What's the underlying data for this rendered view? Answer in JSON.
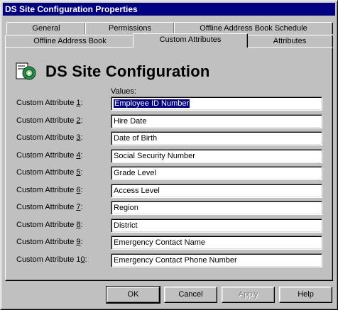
{
  "window": {
    "title": "DS Site Configuration Properties"
  },
  "tabs_back": [
    {
      "label": "General"
    },
    {
      "label": "Permissions"
    },
    {
      "label": "Offline Address Book Schedule"
    }
  ],
  "tabs_front": [
    {
      "label": "Offline Address Book"
    },
    {
      "label": "Custom Attributes",
      "active": true
    },
    {
      "label": "Attributes"
    }
  ],
  "header": {
    "title": "DS Site Configuration",
    "icon": "site-config-icon"
  },
  "values_label": "Values:",
  "attributes": [
    {
      "label_prefix": "Custom Attribute ",
      "key": "1",
      "label_suffix": ":",
      "value": "Employee ID Number",
      "selected": true
    },
    {
      "label_prefix": "Custom Attribute ",
      "key": "2",
      "label_suffix": ":",
      "value": "Hire Date"
    },
    {
      "label_prefix": "Custom Attribute ",
      "key": "3",
      "label_suffix": ":",
      "value": "Date of Birth"
    },
    {
      "label_prefix": "Custom Attribute ",
      "key": "4",
      "label_suffix": ":",
      "value": "Social Security Number"
    },
    {
      "label_prefix": "Custom Attribute ",
      "key": "5",
      "label_suffix": ":",
      "value": "Grade Level"
    },
    {
      "label_prefix": "Custom Attribute ",
      "key": "6",
      "label_suffix": ":",
      "value": "Access Level"
    },
    {
      "label_prefix": "Custom Attribute ",
      "key": "7",
      "label_suffix": ":",
      "value": "Region"
    },
    {
      "label_prefix": "Custom Attribute ",
      "key": "8",
      "label_suffix": ":",
      "value": "District"
    },
    {
      "label_prefix": "Custom Attribute ",
      "key": "9",
      "label_suffix": ":",
      "value": "Emergency Contact Name"
    },
    {
      "label_prefix": "Custom Attribute 1",
      "key": "0",
      "label_suffix": ":",
      "value": "Emergency Contact Phone Number"
    }
  ],
  "buttons": {
    "ok": "OK",
    "cancel": "Cancel",
    "apply": "Apply",
    "help": "Help"
  }
}
